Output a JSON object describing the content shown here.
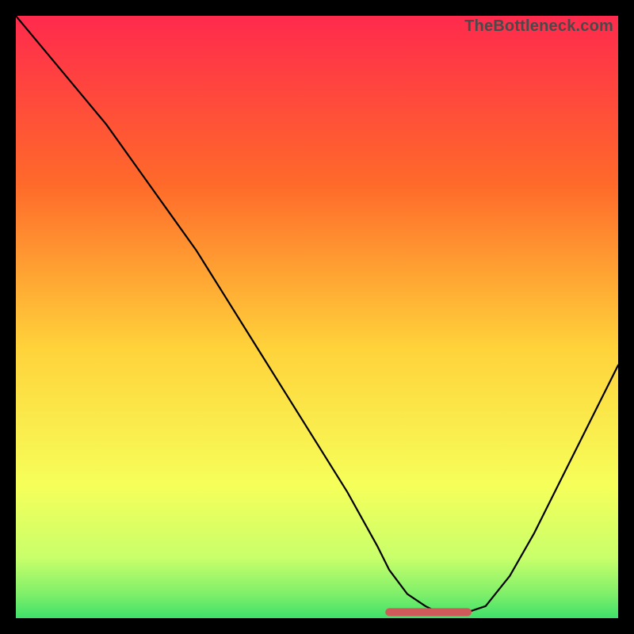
{
  "watermark": "TheBottleneck.com",
  "chart_data": {
    "type": "line",
    "title": "",
    "xlabel": "",
    "ylabel": "",
    "xlim": [
      0,
      100
    ],
    "ylim": [
      0,
      100
    ],
    "grid": false,
    "legend": false,
    "background_gradient": {
      "top": "#ff2a4d",
      "mid_upper": "#ff8a2a",
      "mid": "#ffe23a",
      "mid_lower": "#f7ff6a",
      "bottom": "#3fe06a"
    },
    "series": [
      {
        "name": "bottleneck-curve",
        "x": [
          0,
          5,
          10,
          15,
          20,
          25,
          30,
          35,
          40,
          45,
          50,
          55,
          60,
          62,
          65,
          68,
          70,
          72,
          75,
          78,
          82,
          86,
          90,
          94,
          98,
          100
        ],
        "y": [
          100,
          94,
          88,
          82,
          75,
          68,
          61,
          53,
          45,
          37,
          29,
          21,
          12,
          8,
          4,
          2,
          1,
          1,
          1,
          2,
          7,
          14,
          22,
          30,
          38,
          42
        ]
      }
    ],
    "annotations": [
      {
        "name": "optimal-flat-region",
        "x_start": 62,
        "x_end": 75,
        "y": 1,
        "color": "#cf5a5a"
      }
    ]
  }
}
